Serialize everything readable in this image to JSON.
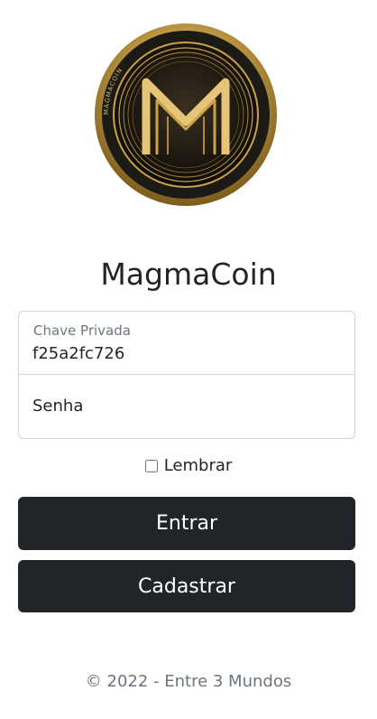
{
  "brand": {
    "title": "MagmaCoin",
    "logo_ring_text": "MAGMACOIN",
    "gold": "#c9a24a",
    "dark": "#1c1a14"
  },
  "login_form": {
    "private_key_label": "Chave Privada",
    "private_key_value": "f25a2fc726",
    "password_placeholder": "Senha",
    "remember_label": "Lembrar",
    "remember_checked": false
  },
  "buttons": {
    "login_label": "Entrar",
    "signup_label": "Cadastrar"
  },
  "footer": {
    "text": "© 2022 - Entre 3 Mundos"
  }
}
